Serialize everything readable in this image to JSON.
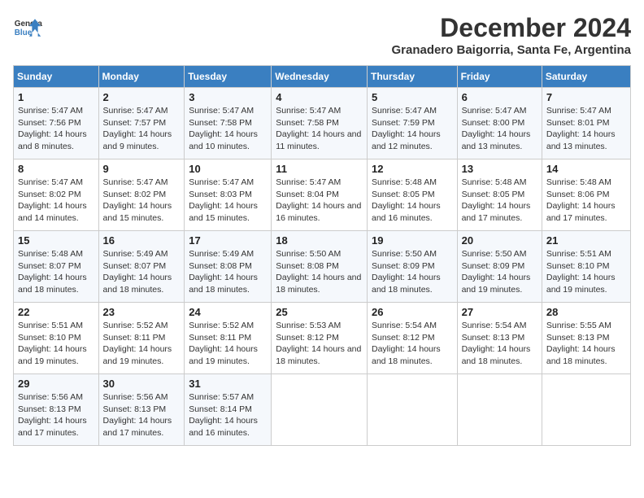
{
  "header": {
    "logo_line1": "General",
    "logo_line2": "Blue",
    "month": "December 2024",
    "location": "Granadero Baigorria, Santa Fe, Argentina"
  },
  "days_of_week": [
    "Sunday",
    "Monday",
    "Tuesday",
    "Wednesday",
    "Thursday",
    "Friday",
    "Saturday"
  ],
  "weeks": [
    [
      {
        "day": "1",
        "sunrise": "5:47 AM",
        "sunset": "7:56 PM",
        "daylight": "14 hours and 8 minutes"
      },
      {
        "day": "2",
        "sunrise": "5:47 AM",
        "sunset": "7:57 PM",
        "daylight": "14 hours and 9 minutes"
      },
      {
        "day": "3",
        "sunrise": "5:47 AM",
        "sunset": "7:58 PM",
        "daylight": "14 hours and 10 minutes"
      },
      {
        "day": "4",
        "sunrise": "5:47 AM",
        "sunset": "7:58 PM",
        "daylight": "14 hours and 11 minutes"
      },
      {
        "day": "5",
        "sunrise": "5:47 AM",
        "sunset": "7:59 PM",
        "daylight": "14 hours and 12 minutes"
      },
      {
        "day": "6",
        "sunrise": "5:47 AM",
        "sunset": "8:00 PM",
        "daylight": "14 hours and 13 minutes"
      },
      {
        "day": "7",
        "sunrise": "5:47 AM",
        "sunset": "8:01 PM",
        "daylight": "14 hours and 13 minutes"
      }
    ],
    [
      {
        "day": "8",
        "sunrise": "5:47 AM",
        "sunset": "8:02 PM",
        "daylight": "14 hours and 14 minutes"
      },
      {
        "day": "9",
        "sunrise": "5:47 AM",
        "sunset": "8:02 PM",
        "daylight": "14 hours and 15 minutes"
      },
      {
        "day": "10",
        "sunrise": "5:47 AM",
        "sunset": "8:03 PM",
        "daylight": "14 hours and 15 minutes"
      },
      {
        "day": "11",
        "sunrise": "5:47 AM",
        "sunset": "8:04 PM",
        "daylight": "14 hours and 16 minutes"
      },
      {
        "day": "12",
        "sunrise": "5:48 AM",
        "sunset": "8:05 PM",
        "daylight": "14 hours and 16 minutes"
      },
      {
        "day": "13",
        "sunrise": "5:48 AM",
        "sunset": "8:05 PM",
        "daylight": "14 hours and 17 minutes"
      },
      {
        "day": "14",
        "sunrise": "5:48 AM",
        "sunset": "8:06 PM",
        "daylight": "14 hours and 17 minutes"
      }
    ],
    [
      {
        "day": "15",
        "sunrise": "5:48 AM",
        "sunset": "8:07 PM",
        "daylight": "14 hours and 18 minutes"
      },
      {
        "day": "16",
        "sunrise": "5:49 AM",
        "sunset": "8:07 PM",
        "daylight": "14 hours and 18 minutes"
      },
      {
        "day": "17",
        "sunrise": "5:49 AM",
        "sunset": "8:08 PM",
        "daylight": "14 hours and 18 minutes"
      },
      {
        "day": "18",
        "sunrise": "5:50 AM",
        "sunset": "8:08 PM",
        "daylight": "14 hours and 18 minutes"
      },
      {
        "day": "19",
        "sunrise": "5:50 AM",
        "sunset": "8:09 PM",
        "daylight": "14 hours and 18 minutes"
      },
      {
        "day": "20",
        "sunrise": "5:50 AM",
        "sunset": "8:09 PM",
        "daylight": "14 hours and 19 minutes"
      },
      {
        "day": "21",
        "sunrise": "5:51 AM",
        "sunset": "8:10 PM",
        "daylight": "14 hours and 19 minutes"
      }
    ],
    [
      {
        "day": "22",
        "sunrise": "5:51 AM",
        "sunset": "8:10 PM",
        "daylight": "14 hours and 19 minutes"
      },
      {
        "day": "23",
        "sunrise": "5:52 AM",
        "sunset": "8:11 PM",
        "daylight": "14 hours and 19 minutes"
      },
      {
        "day": "24",
        "sunrise": "5:52 AM",
        "sunset": "8:11 PM",
        "daylight": "14 hours and 19 minutes"
      },
      {
        "day": "25",
        "sunrise": "5:53 AM",
        "sunset": "8:12 PM",
        "daylight": "14 hours and 18 minutes"
      },
      {
        "day": "26",
        "sunrise": "5:54 AM",
        "sunset": "8:12 PM",
        "daylight": "14 hours and 18 minutes"
      },
      {
        "day": "27",
        "sunrise": "5:54 AM",
        "sunset": "8:13 PM",
        "daylight": "14 hours and 18 minutes"
      },
      {
        "day": "28",
        "sunrise": "5:55 AM",
        "sunset": "8:13 PM",
        "daylight": "14 hours and 18 minutes"
      }
    ],
    [
      {
        "day": "29",
        "sunrise": "5:56 AM",
        "sunset": "8:13 PM",
        "daylight": "14 hours and 17 minutes"
      },
      {
        "day": "30",
        "sunrise": "5:56 AM",
        "sunset": "8:13 PM",
        "daylight": "14 hours and 17 minutes"
      },
      {
        "day": "31",
        "sunrise": "5:57 AM",
        "sunset": "8:14 PM",
        "daylight": "14 hours and 16 minutes"
      },
      null,
      null,
      null,
      null
    ]
  ],
  "labels": {
    "sunrise": "Sunrise:",
    "sunset": "Sunset:",
    "daylight": "Daylight:"
  }
}
